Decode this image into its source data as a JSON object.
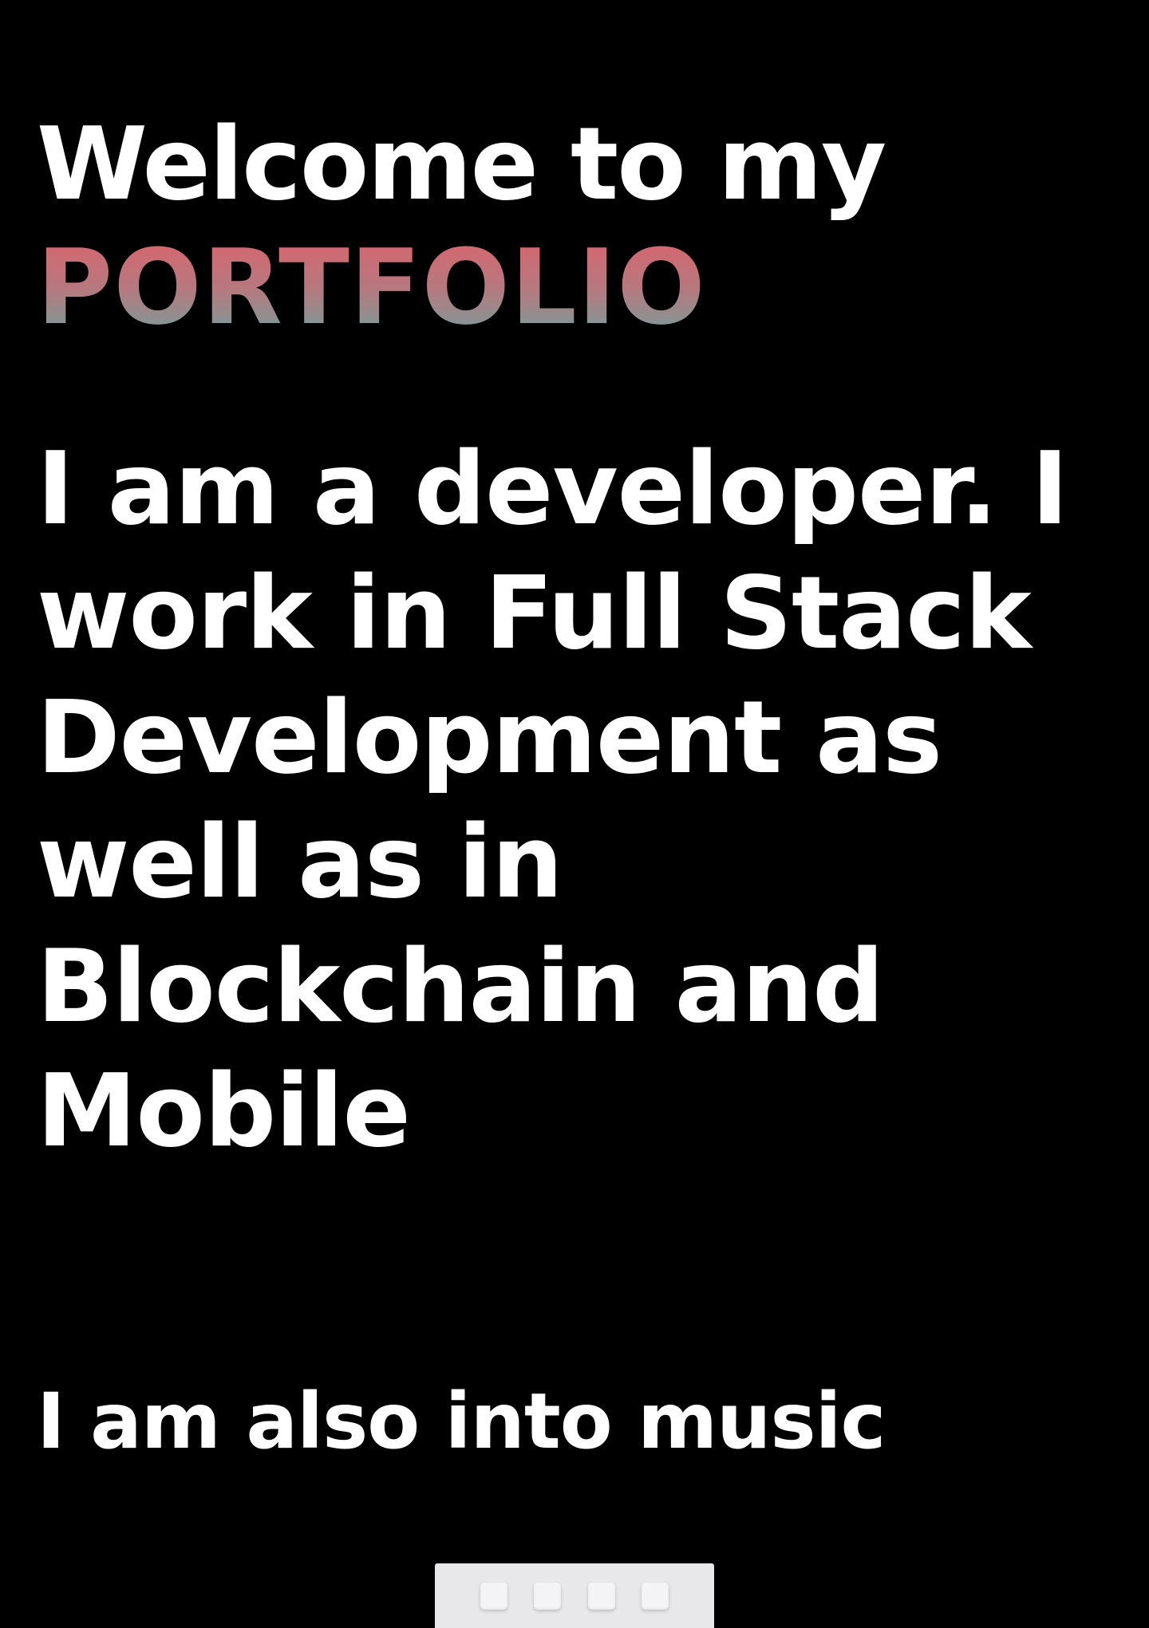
{
  "hero": {
    "welcome_text": "Welcome to my",
    "portfolio_text": "PORTFOLIO"
  },
  "intro": {
    "text": "I am a developer. I work in Full Stack Development as well as in Blockchain and Mobile"
  },
  "music": {
    "text": "I am also into music"
  },
  "dock": {
    "items": [
      "dock-item",
      "dock-item",
      "dock-item",
      "dock-item"
    ]
  },
  "colors": {
    "background": "#000000",
    "text": "#ffffff",
    "gradient_top": "#e0606a",
    "gradient_bottom": "#6aa5a1"
  }
}
